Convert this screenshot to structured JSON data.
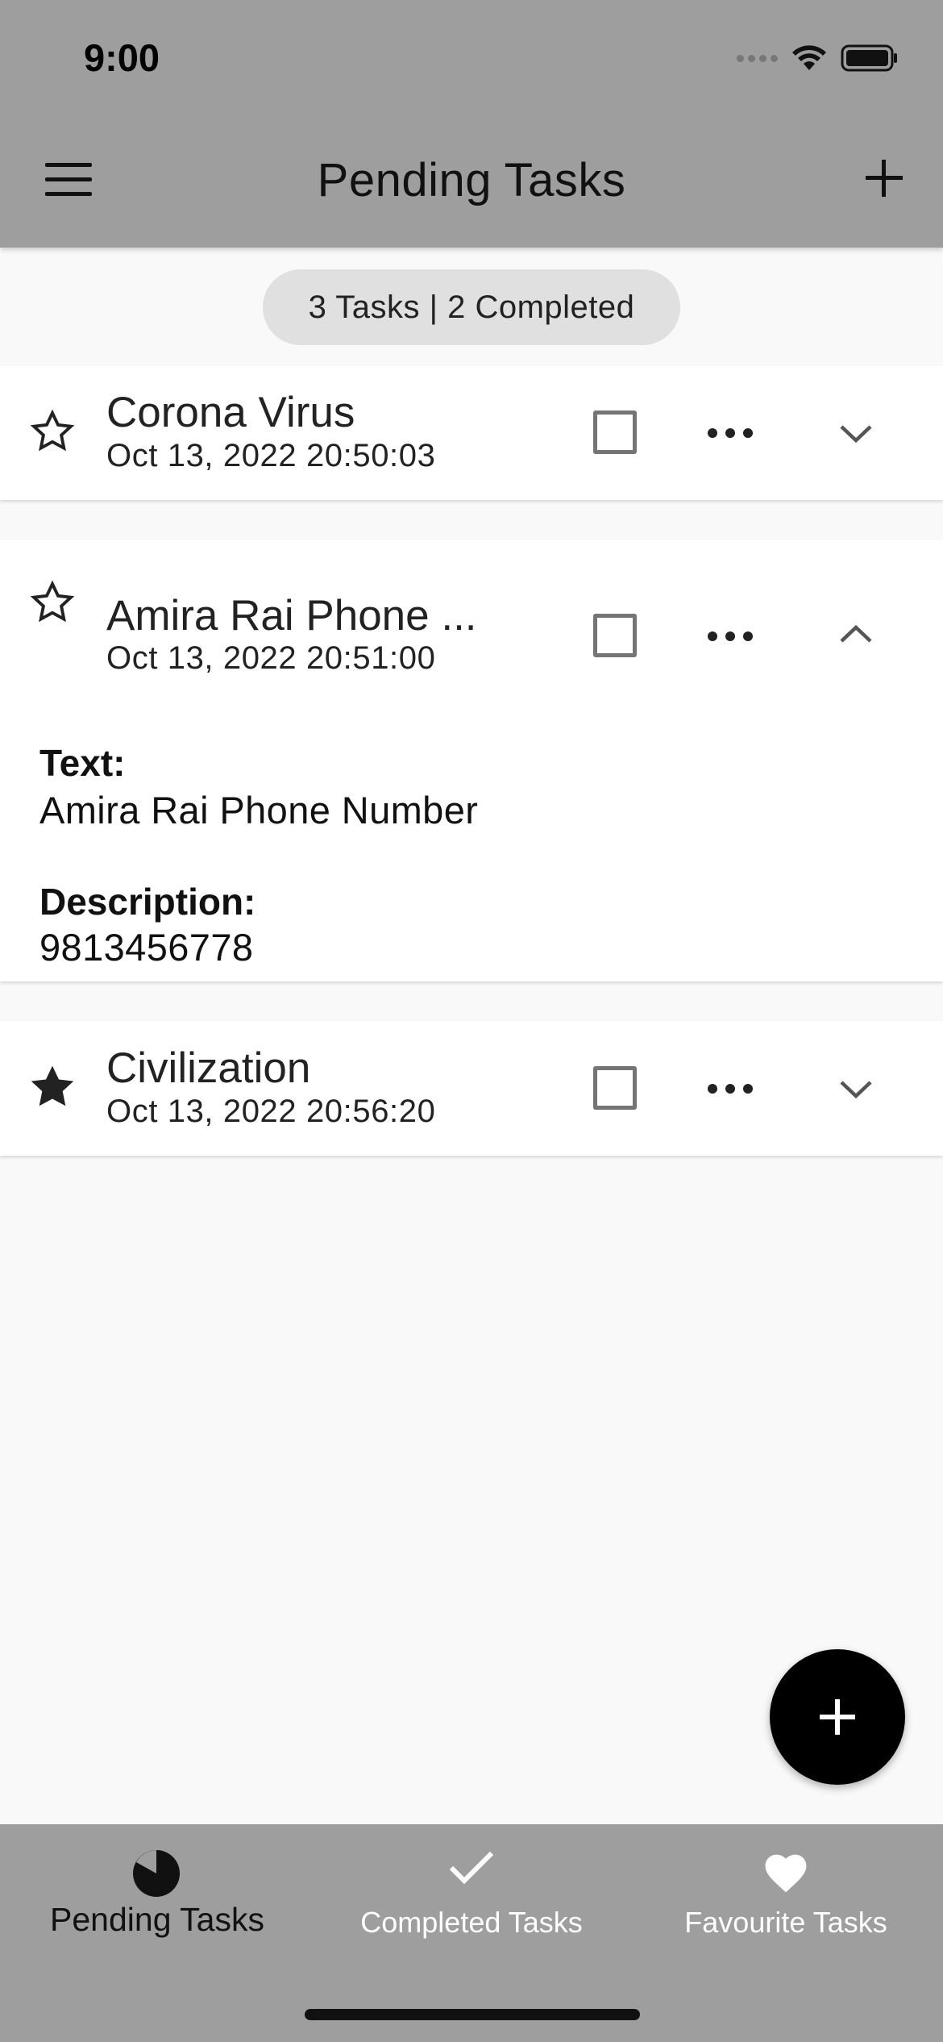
{
  "status_bar": {
    "time": "9:00"
  },
  "app_bar": {
    "title": "Pending Tasks"
  },
  "summary": {
    "text": "3 Tasks | 2 Completed"
  },
  "tasks": [
    {
      "title": "Corona Virus",
      "date": "Oct 13, 2022 20:50:03",
      "favourite": false,
      "completed": false,
      "expanded": false
    },
    {
      "title": "Amira Rai Phone ...",
      "date": "Oct 13, 2022 20:51:00",
      "favourite": false,
      "completed": false,
      "expanded": true,
      "details": {
        "text_label": "Text:",
        "text_value": "Amira Rai Phone Number",
        "description_label": "Description:",
        "description_value": "9813456778"
      }
    },
    {
      "title": "Civilization",
      "date": "Oct 13, 2022 20:56:20",
      "favourite": true,
      "completed": false,
      "expanded": false
    }
  ],
  "bottom_nav": {
    "items": [
      {
        "label": "Pending Tasks",
        "icon": "pie-progress-icon",
        "active": true
      },
      {
        "label": "Completed Tasks",
        "icon": "check-icon",
        "active": false
      },
      {
        "label": "Favourite Tasks",
        "icon": "heart-icon",
        "active": false
      }
    ]
  },
  "colors": {
    "app_bar": "#9e9e9e",
    "background": "#f9f9f9",
    "card": "#ffffff",
    "pill": "#e0e0e0",
    "fab": "#000000",
    "active_nav_text": "#111111",
    "inactive_nav_text": "#ffffff"
  }
}
